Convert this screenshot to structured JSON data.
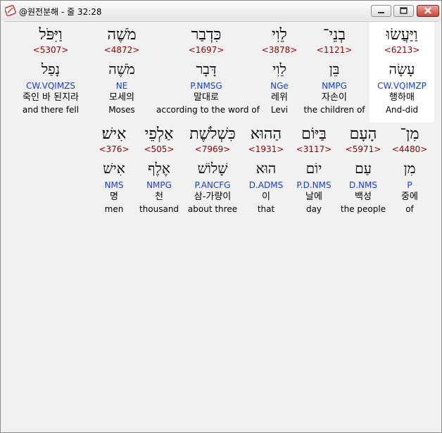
{
  "window": {
    "title": "@원전분해 - 줄 32:28",
    "icon": "app-icon",
    "buttons": [
      "minimize-button",
      "maximize-button",
      "close-button"
    ]
  },
  "rows": [
    {
      "words": [
        {
          "heb": "וַיַּעֲשׂוּ",
          "num": "<6213>",
          "lemma": "עָשָׂה",
          "morph": "CW.VQIMZP",
          "kor": "행하매",
          "eng": "And-did",
          "selected": true
        },
        {
          "heb": "בְנֵי־",
          "num": "<1121>",
          "lemma": "בֵּן",
          "morph": "NMPG",
          "kor": "자손이",
          "eng": "the children of"
        },
        {
          "heb": "לֵוִי",
          "num": "<3878>",
          "lemma": "לֵוִי",
          "morph": "NGe",
          "kor": "레위",
          "eng": "Levi"
        },
        {
          "heb": "כִּדְבַר",
          "num": "<1697>",
          "lemma": "דָּבָר",
          "morph": "P.NMSG",
          "kor": "말대로",
          "eng": "according to the word of"
        },
        {
          "heb": "מֹשֶׁה",
          "num": "<4872>",
          "lemma": "מֹשֶׁה",
          "morph": "NE",
          "kor": "모세의",
          "eng": "Moses"
        },
        {
          "heb": "וַיִּפֹּל",
          "num": "<5307>",
          "lemma": "נָפַל",
          "morph": "CW.VQIMZS",
          "kor": "죽인 바 된지라",
          "eng": "and there fell"
        }
      ]
    },
    {
      "words": [
        {
          "heb": "מִן־",
          "num": "<4480>",
          "lemma": "מִן",
          "morph": "P",
          "kor": "중에",
          "eng": "of"
        },
        {
          "heb": "הָעָם",
          "num": "<5971>",
          "lemma": "עַם",
          "morph": "D.NMS",
          "kor": "백성",
          "eng": "the people"
        },
        {
          "heb": "בַּיּוֹם",
          "num": "<3117>",
          "lemma": "יוֹם",
          "morph": "P.D.NMS",
          "kor": "날에",
          "eng": "day"
        },
        {
          "heb": "הַהוּא",
          "num": "<1931>",
          "lemma": "הוּא",
          "morph": "D.ADMS",
          "kor": "이",
          "eng": "that"
        },
        {
          "heb": "כִּשְׁלֹשֶׁת",
          "num": "<7969>",
          "lemma": "שָׁלוֹשׁ",
          "morph": "P.ANCFG",
          "kor": "삼-가량이",
          "eng": "about three"
        },
        {
          "heb": "אַלְפֵי",
          "num": "<505>",
          "lemma": "אֶלֶף",
          "morph": "NMPG",
          "kor": "천",
          "eng": "thousand"
        },
        {
          "heb": "אִישׁ׃",
          "num": "<376>",
          "lemma": "אִישׁ",
          "morph": "NMS",
          "kor": "명",
          "eng": "men"
        }
      ]
    }
  ]
}
